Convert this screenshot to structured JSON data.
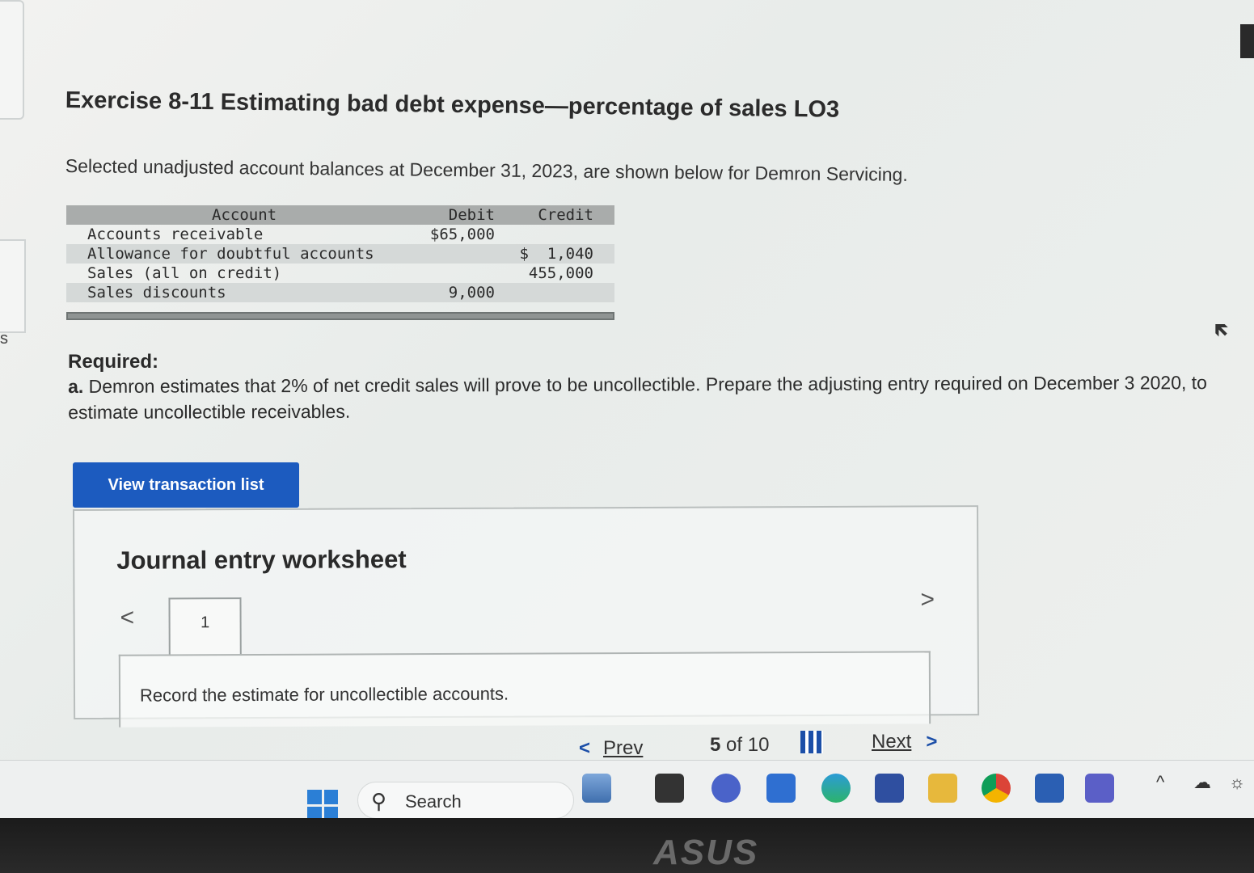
{
  "left_edge_text": "s",
  "exercise": {
    "title": "Exercise 8-11 Estimating bad debt expense—percentage of sales LO3",
    "intro": "Selected unadjusted account balances at December 31, 2023, are shown below for Demron Servicing."
  },
  "ledger": {
    "headers": {
      "account": "Account",
      "debit": "Debit",
      "credit": "Credit"
    },
    "rows": [
      {
        "account": "Accounts receivable",
        "debit": "$65,000",
        "credit": ""
      },
      {
        "account": "Allowance for doubtful accounts",
        "debit": "",
        "credit": "$  1,040"
      },
      {
        "account": "Sales (all on credit)",
        "debit": "",
        "credit": "455,000"
      },
      {
        "account": "Sales discounts",
        "debit": "9,000",
        "credit": ""
      }
    ]
  },
  "required": {
    "label": "Required:",
    "part_letter": "a.",
    "text": " Demron estimates that 2% of net credit sales will prove to be uncollectible. Prepare the adjusting entry required on December 3 2020, to estimate uncollectible receivables."
  },
  "view_button": "View transaction list",
  "worksheet": {
    "title": "Journal entry worksheet",
    "prev_arrow": "<",
    "next_arrow": ">",
    "tab": "1",
    "instruction": "Record the estimate for uncollectible accounts."
  },
  "pager": {
    "prev_arrow": "<",
    "prev": "Prev",
    "current": "5",
    "of": "of",
    "total": "10",
    "next": "Next",
    "next_arrow": ">"
  },
  "taskbar": {
    "search_label": "Search",
    "search_icon": "magnifier-icon",
    "tray_chevron": "^"
  },
  "brand": "ASUS",
  "colors": {
    "button_bg": "#1c5bbf",
    "link": "#1c4fa8",
    "ledger_header": "#a9acab"
  }
}
